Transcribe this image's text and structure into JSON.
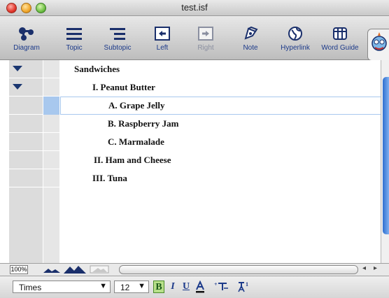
{
  "window": {
    "title": "test.isf"
  },
  "toolbar": {
    "items": [
      {
        "label": "Diagram",
        "icon": "diagram-icon"
      },
      {
        "label": "Topic",
        "icon": "topic-icon"
      },
      {
        "label": "Subtopic",
        "icon": "subtopic-icon"
      },
      {
        "label": "Left",
        "icon": "left-arrow-icon"
      },
      {
        "label": "Right",
        "icon": "right-arrow-icon"
      },
      {
        "label": "Note",
        "icon": "note-icon"
      },
      {
        "label": "Hyperlink",
        "icon": "hyperlink-icon"
      },
      {
        "label": "Word Guide",
        "icon": "word-guide-icon"
      }
    ]
  },
  "outline": {
    "rows": [
      {
        "text": "Sandwiches",
        "expanded": true
      },
      {
        "text": "I.  Peanut Butter",
        "expanded": true
      },
      {
        "text": "A.  Grape Jelly",
        "selected": true
      },
      {
        "text": "B.  Raspberry Jam"
      },
      {
        "text": "C.  Marmalade"
      },
      {
        "text": "II.  Ham and Cheese"
      },
      {
        "text": "III.  Tuna"
      }
    ]
  },
  "statusbar": {
    "zoom": "100%"
  },
  "format": {
    "font": "Times",
    "size": "12",
    "bold_active": true
  },
  "colors": {
    "accent": "#1c3a8a",
    "selection": "#a8c8ee",
    "bold_active": "#b8e08a"
  }
}
